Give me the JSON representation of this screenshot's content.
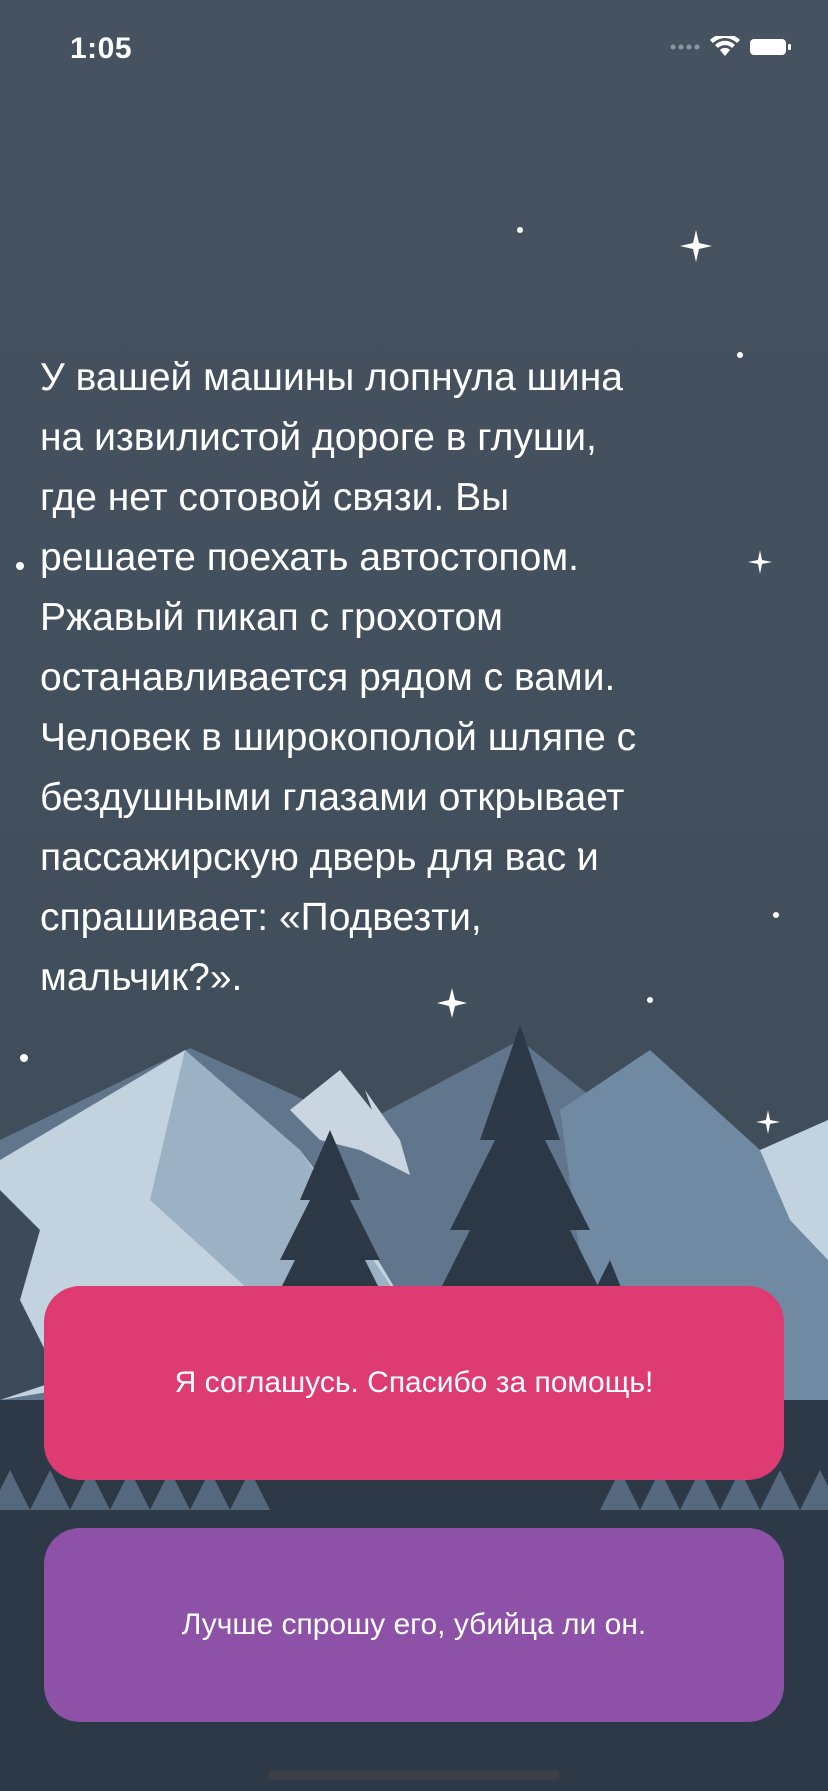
{
  "status_bar": {
    "time": "1:05",
    "icons": [
      "signal-dots-icon",
      "wifi-icon",
      "battery-icon"
    ]
  },
  "story": {
    "text": "У вашей машины лопнула шина\nна извилистой дороге в глуши,\nгде нет сотовой связи. Вы\nрешаете поехать автостопом.\nРжавый пикап с грохотом\nостанавливается рядом с вами.\nЧеловек в широкополой шляпе с\nбездушными глазами открывает\nпассажирскую дверь для вас и\nспрашивает: «Подвезти,\nмальчик?»."
  },
  "choices": [
    {
      "label": "Я соглашусь. Спасибо за помощь!",
      "color": "#df3b73"
    },
    {
      "label": "Лучше спрошу его, убийца ли он.",
      "color": "#8d52a8"
    }
  ],
  "colors": {
    "sky": "#434f5d",
    "mountain_light": "#b8c8d6",
    "mountain_mid": "#7d91a7",
    "trees_dark": "#2b3643"
  }
}
